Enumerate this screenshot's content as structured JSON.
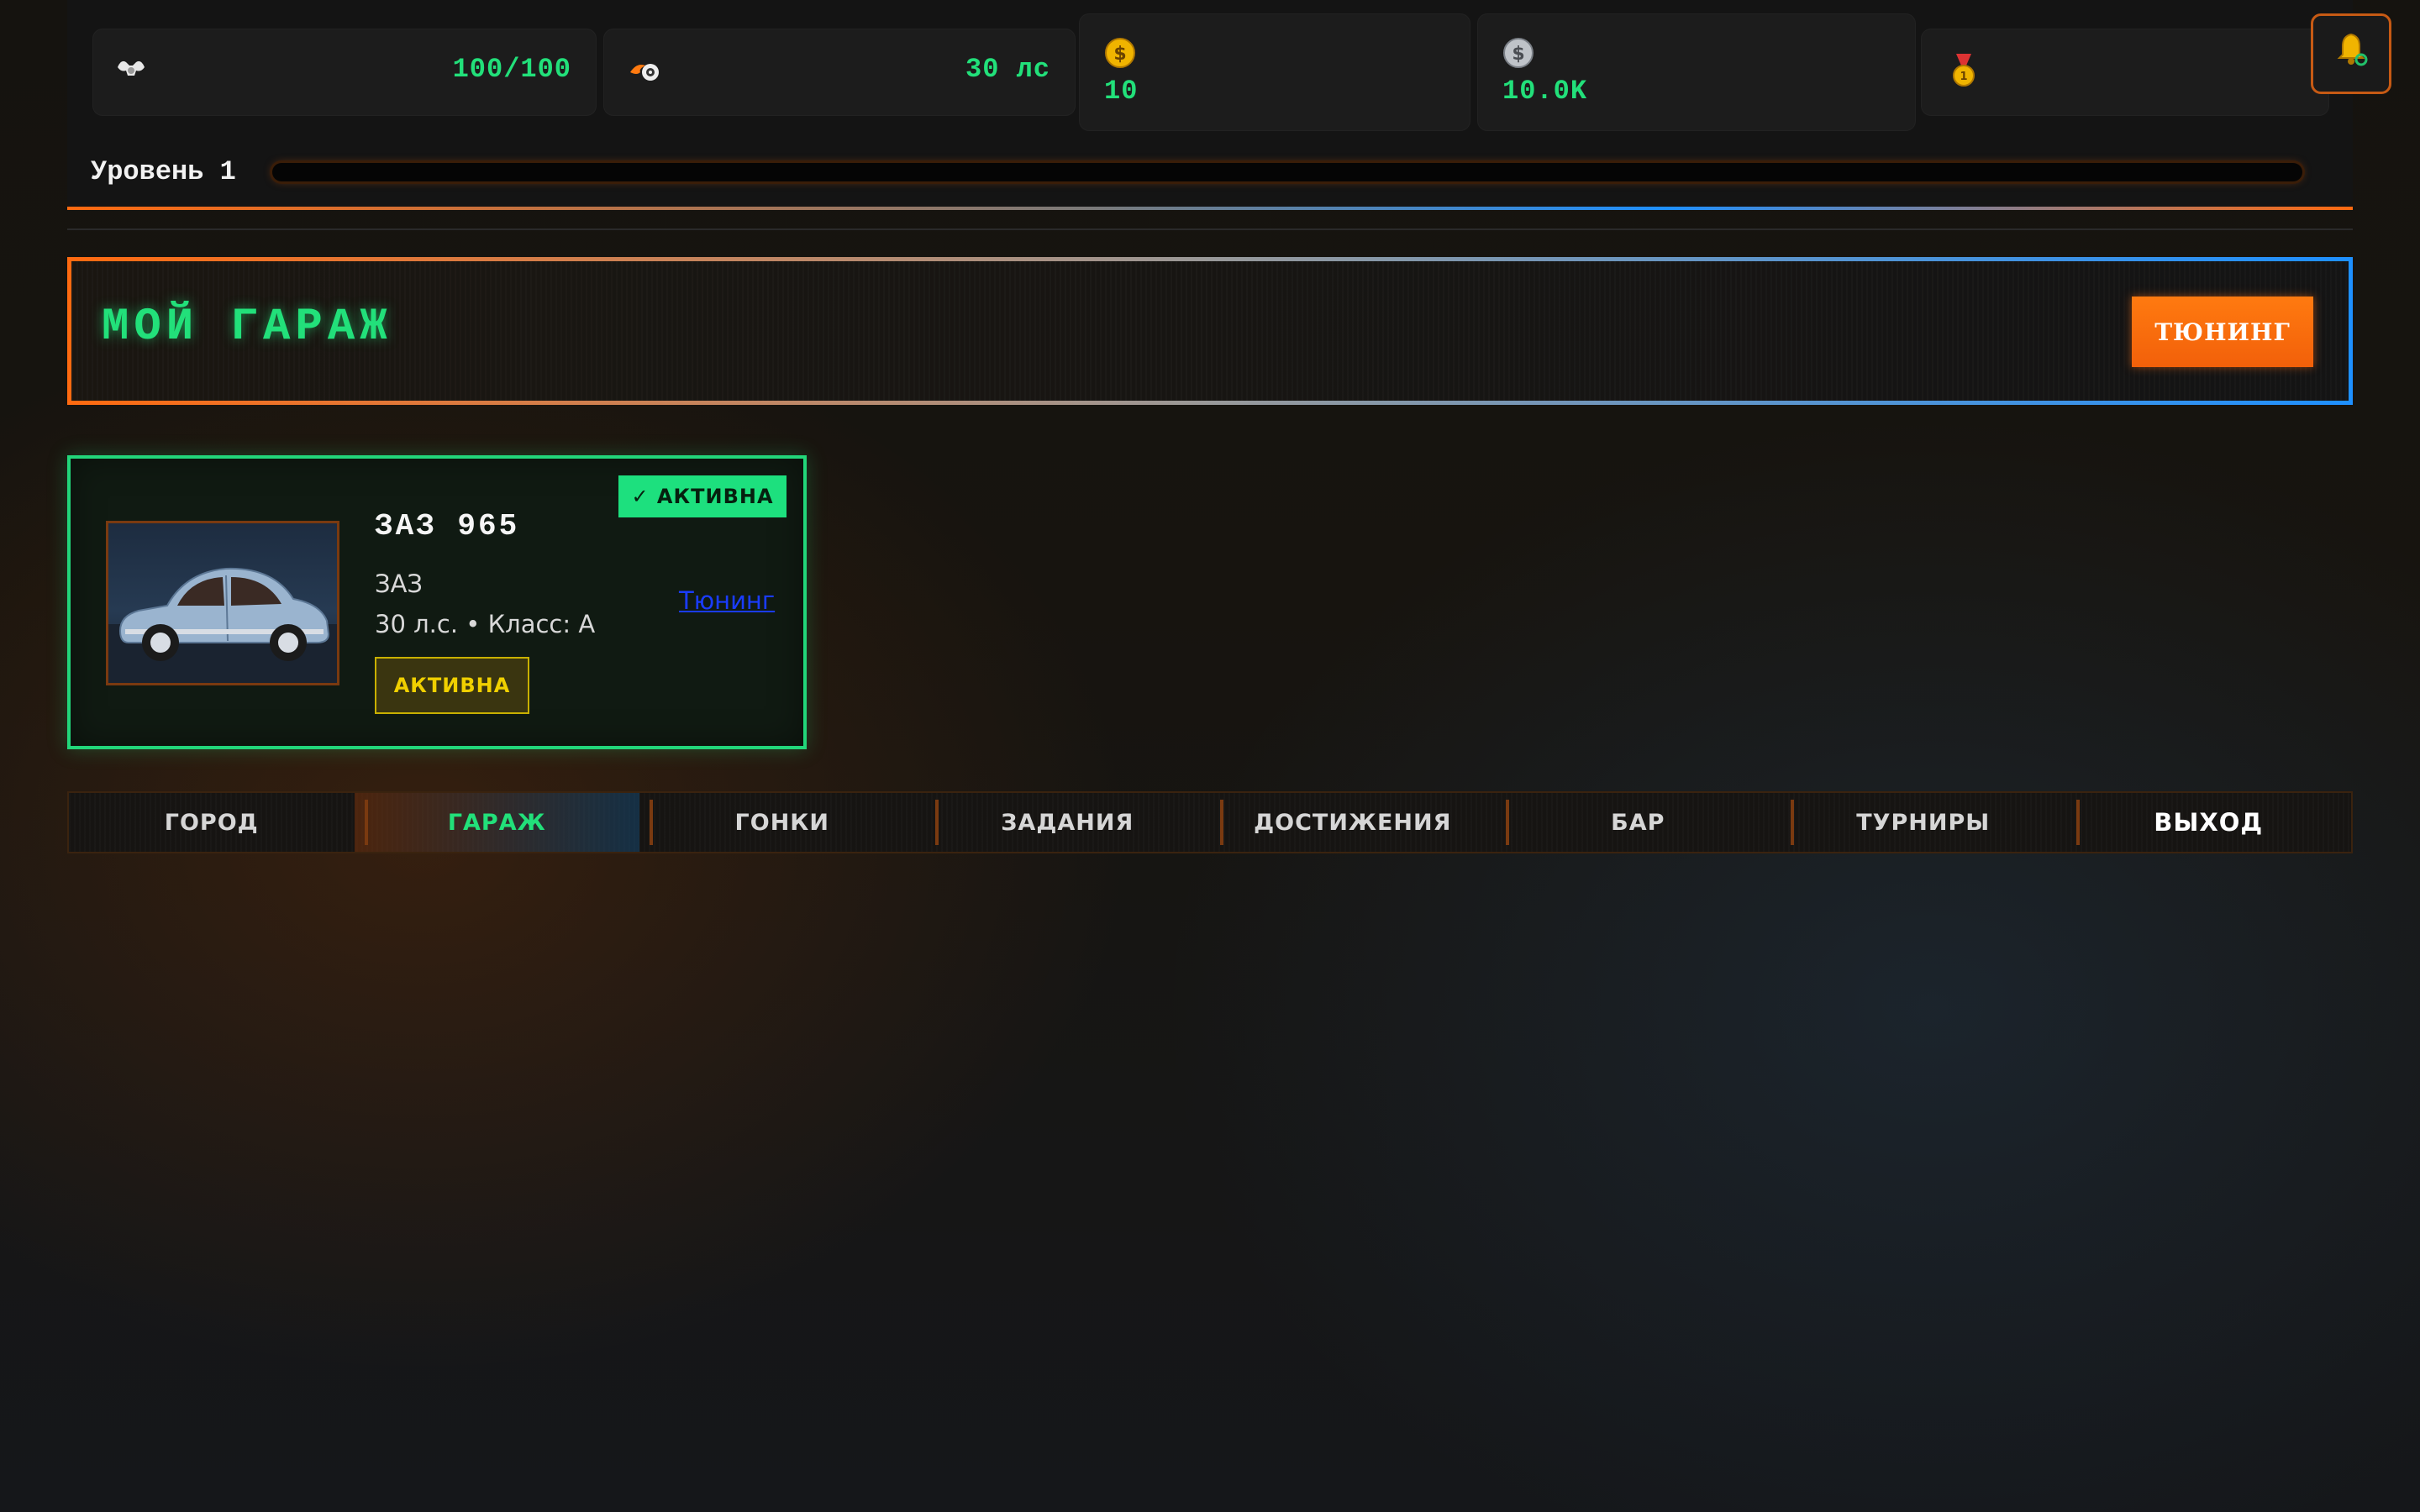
{
  "topbar": {
    "energy": {
      "icon": "muscle-icon",
      "value": "100/100"
    },
    "power": {
      "icon": "flame-wheel-icon",
      "value": "30 лс"
    },
    "gold": {
      "icon": "gold-coin-icon",
      "value": "10"
    },
    "silver": {
      "icon": "silver-coin-icon",
      "value": "10.0K"
    },
    "medal": {
      "icon": "medal-icon",
      "value": ""
    },
    "bell": {
      "icon": "bell-icon"
    },
    "level": {
      "label": "Уровень 1",
      "progress": 0.0
    }
  },
  "garage": {
    "title": "МОЙ ГАРАЖ",
    "tuning_button": "ТЮНИНГ"
  },
  "car": {
    "badge": "✓ АКТИВНА",
    "name": "ЗАЗ 965",
    "brand": "ЗАЗ",
    "spec": "30 л.с. • Класс: A",
    "status": "АКТИВНА",
    "tuning_link": "Тюнинг"
  },
  "nav": {
    "items": [
      {
        "label": "ГОРОД"
      },
      {
        "label": "ГАРАЖ",
        "active": true
      },
      {
        "label": "ГОНКИ"
      },
      {
        "label": "ЗАДАНИЯ"
      },
      {
        "label": "ДОСТИЖЕНИЯ"
      },
      {
        "label": "БАР"
      },
      {
        "label": "ТУРНИРЫ"
      },
      {
        "label": "ВЫХОД"
      }
    ]
  },
  "colors": {
    "accent_green": "#22e07a",
    "accent_orange": "#ff6a10",
    "accent_blue": "#1e90ff",
    "status_yellow": "#f0d000"
  }
}
